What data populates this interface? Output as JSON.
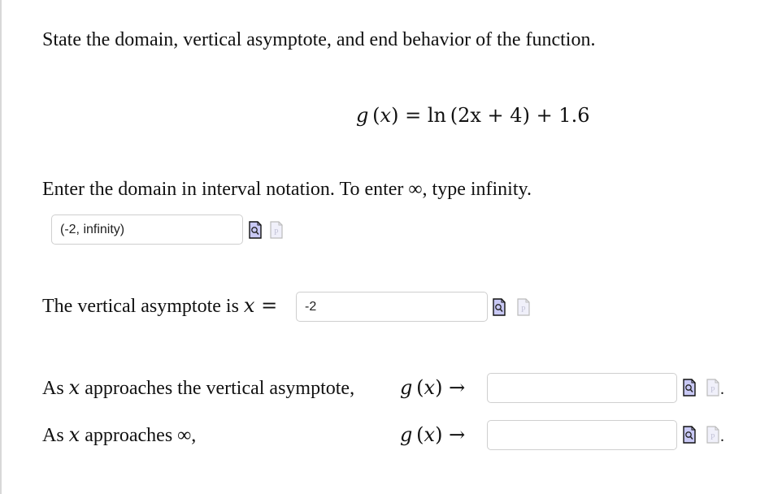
{
  "question": {
    "prompt": "State the domain, vertical asymptote, and end behavior of the function.",
    "function": {
      "lhs_name": "g",
      "lhs_var": "x",
      "rhs_fn": "ln",
      "rhs_inner": "2x + 4",
      "rhs_tail": "+ 1.6"
    }
  },
  "domain_part": {
    "instruction_before": "Enter the domain in interval notation. To enter ",
    "infinity_symbol": "∞",
    "instruction_after": ", type infinity.",
    "answer_value": "(-2, infinity)",
    "answer_placeholder": ""
  },
  "asymptote_part": {
    "label_text": "The vertical asymptote is ",
    "label_var": "x",
    "label_eq": "=",
    "answer_value": "-2"
  },
  "end_behavior": [
    {
      "label_prefix": "As ",
      "label_var": "x",
      "label_suffix": " approaches the vertical asymptote,",
      "fn_text": "g",
      "fn_var": "x",
      "arrow": "→",
      "answer_value": ""
    },
    {
      "label_prefix": "As ",
      "label_var": "x",
      "label_suffix": " approaches ∞,",
      "fn_text": "g",
      "fn_var": "x",
      "arrow": "→",
      "answer_value": ""
    }
  ],
  "icons": {
    "preview": "preview-magnifier-icon",
    "palette": "math-palette-icon"
  },
  "colors": {
    "preview_icon_fill": "#c9c9f5",
    "palette_icon_fill": "#f0f0fa",
    "input_border": "#cfcfcf"
  },
  "trailing_period": "."
}
